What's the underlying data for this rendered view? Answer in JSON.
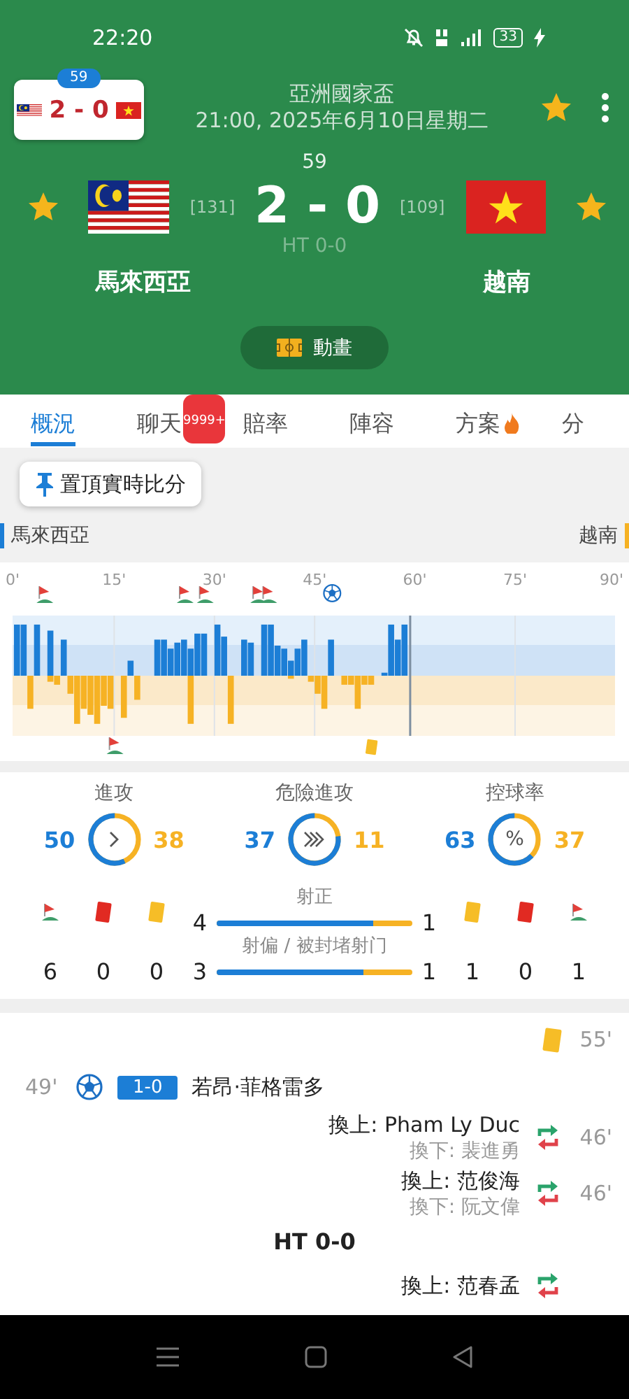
{
  "status_bar": {
    "time": "22:20",
    "battery": "33"
  },
  "mini_score": {
    "minute": "59",
    "score": "2 - 0"
  },
  "match": {
    "competition": "亞洲國家盃",
    "kickoff": "21:00, 2025年6月10日星期二",
    "minute": "59",
    "score": "2 - 0",
    "half_time": "HT 0-0",
    "home": {
      "name": "馬來西亞",
      "rank": "[131]"
    },
    "away": {
      "name": "越南",
      "rank": "[109]"
    }
  },
  "animation_button": "動畫",
  "tabs": [
    {
      "label": "概況",
      "selected": true
    },
    {
      "label": "聊天",
      "selected": false,
      "badge": "9999+"
    },
    {
      "label": "賠率",
      "selected": false
    },
    {
      "label": "陣容",
      "selected": false
    },
    {
      "label": "方案",
      "selected": false,
      "hot": true
    },
    {
      "label": "分",
      "selected": false
    }
  ],
  "pin_button": "置頂實時比分",
  "legend": {
    "home": "馬來西亞",
    "away": "越南"
  },
  "timeline": {
    "ticks": [
      "0'",
      "15'",
      "30'",
      "45'",
      "60'",
      "75'",
      "90'"
    ]
  },
  "stats": {
    "rings": [
      {
        "label": "進攻",
        "home": "50",
        "away": "38",
        "level": 0.568,
        "kind": "chevron"
      },
      {
        "label": "危險進攻",
        "home": "37",
        "away": "11",
        "level": 0.771,
        "kind": "triple-chevron"
      },
      {
        "label": "控球率",
        "home": "63",
        "away": "37",
        "level": 0.63,
        "kind": "percent",
        "symbol": "%"
      }
    ],
    "home_counts": [
      {
        "kind": "corner",
        "value": "6"
      },
      {
        "kind": "red-card",
        "value": "0"
      },
      {
        "kind": "yellow-card",
        "value": "0"
      }
    ],
    "away_counts": [
      {
        "kind": "yellow-card",
        "value": "1"
      },
      {
        "kind": "red-card",
        "value": "0"
      },
      {
        "kind": "corner",
        "value": "1"
      }
    ],
    "shot_bars": [
      {
        "label": "射正",
        "home": "4",
        "away": "1",
        "level": 0.8
      },
      {
        "label": "射偏 / 被封堵射门",
        "home": "3",
        "away": "1",
        "level": 0.75
      }
    ]
  },
  "events": [
    {
      "kind": "yellow-card",
      "home_side": false,
      "minute": "55'"
    },
    {
      "kind": "goal",
      "home_side": true,
      "minute": "49'",
      "score": "1-0",
      "player": "若昂·菲格雷多"
    },
    {
      "kind": "substitution",
      "home_side": false,
      "minute": "46'",
      "player_in": "換上: Pham Ly Duc",
      "player_out": "換下: 裴進勇"
    },
    {
      "kind": "substitution",
      "home_side": false,
      "minute": "46'",
      "player_in": "換上: 范俊海",
      "player_out": "換下: 阮文偉"
    },
    {
      "kind": "period",
      "text": "HT 0-0"
    },
    {
      "kind": "substitution",
      "home_side": false,
      "player_in": "換上: 范春孟"
    }
  ]
}
